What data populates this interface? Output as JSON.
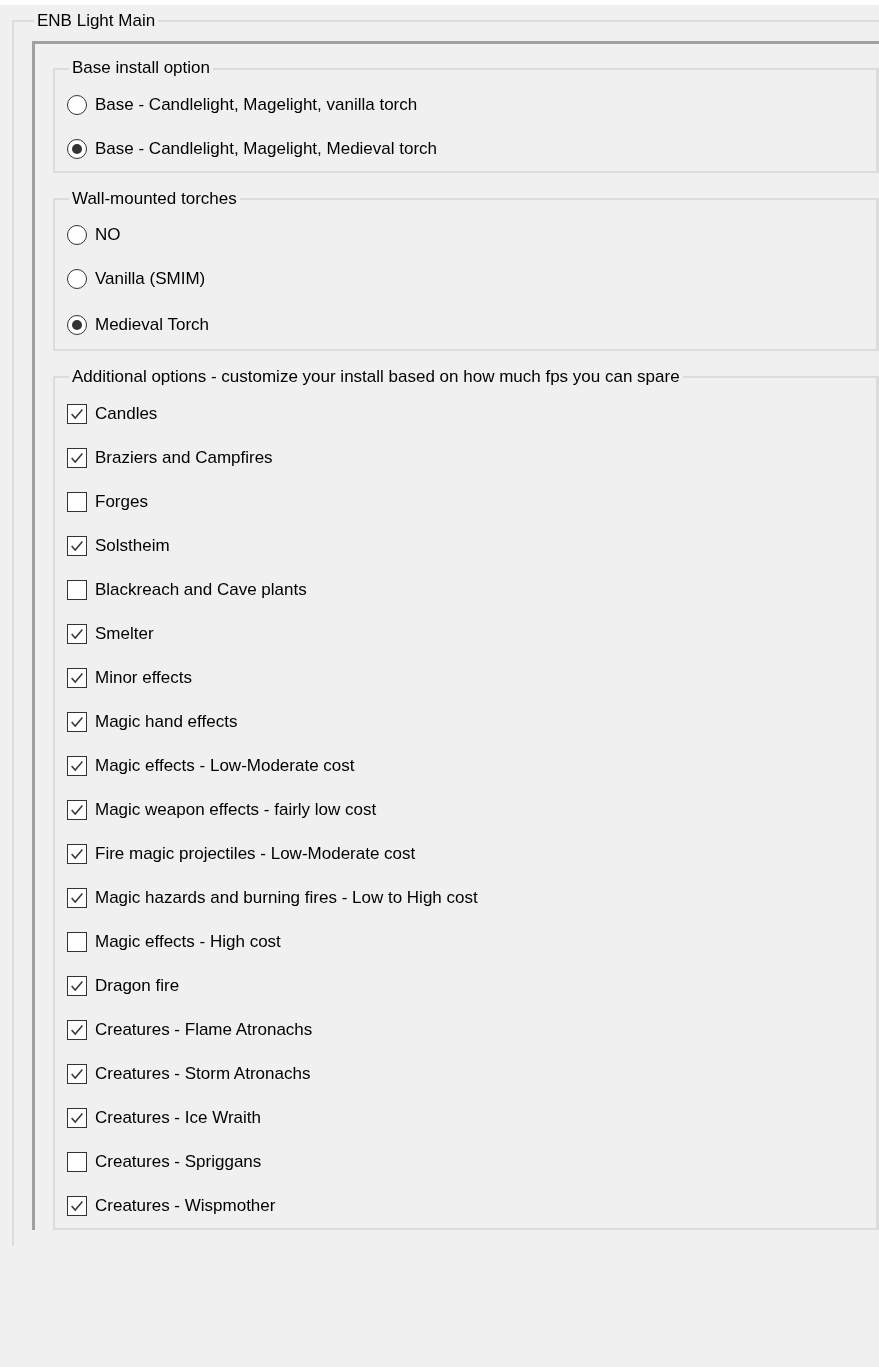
{
  "group": {
    "title": "ENB Light Main",
    "sections": [
      {
        "title": "Base install option",
        "kind": "radio",
        "options": [
          {
            "label": "Base - Candlelight, Magelight, vanilla torch",
            "selected": false
          },
          {
            "label": "Base - Candlelight, Magelight, Medieval torch",
            "selected": true
          }
        ]
      },
      {
        "title": "Wall-mounted torches",
        "kind": "radio",
        "options": [
          {
            "label": "NO",
            "selected": false
          },
          {
            "label": "Vanilla (SMIM)",
            "selected": false
          },
          {
            "label": "Medieval Torch",
            "selected": true
          }
        ]
      },
      {
        "title": "Additional options - customize your install based on how much fps you can spare",
        "kind": "checkbox",
        "options": [
          {
            "label": "Candles",
            "checked": true
          },
          {
            "label": "Braziers and Campfires",
            "checked": true
          },
          {
            "label": "Forges",
            "checked": false
          },
          {
            "label": "Solstheim",
            "checked": true
          },
          {
            "label": "Blackreach and Cave plants",
            "checked": false
          },
          {
            "label": "Smelter",
            "checked": true
          },
          {
            "label": "Minor effects",
            "checked": true
          },
          {
            "label": "Magic hand effects",
            "checked": true
          },
          {
            "label": "Magic effects - Low-Moderate cost",
            "checked": true
          },
          {
            "label": "Magic weapon effects - fairly low cost",
            "checked": true
          },
          {
            "label": "Fire magic projectiles - Low-Moderate cost",
            "checked": true
          },
          {
            "label": "Magic hazards and burning fires - Low to High cost",
            "checked": true
          },
          {
            "label": "Magic effects - High cost",
            "checked": false
          },
          {
            "label": "Dragon fire",
            "checked": true
          },
          {
            "label": "Creatures - Flame Atronachs",
            "checked": true
          },
          {
            "label": "Creatures - Storm Atronachs",
            "checked": true
          },
          {
            "label": "Creatures - Ice Wraith",
            "checked": true
          },
          {
            "label": "Creatures - Spriggans",
            "checked": false
          },
          {
            "label": "Creatures - Wispmother",
            "checked": true
          }
        ]
      }
    ]
  }
}
